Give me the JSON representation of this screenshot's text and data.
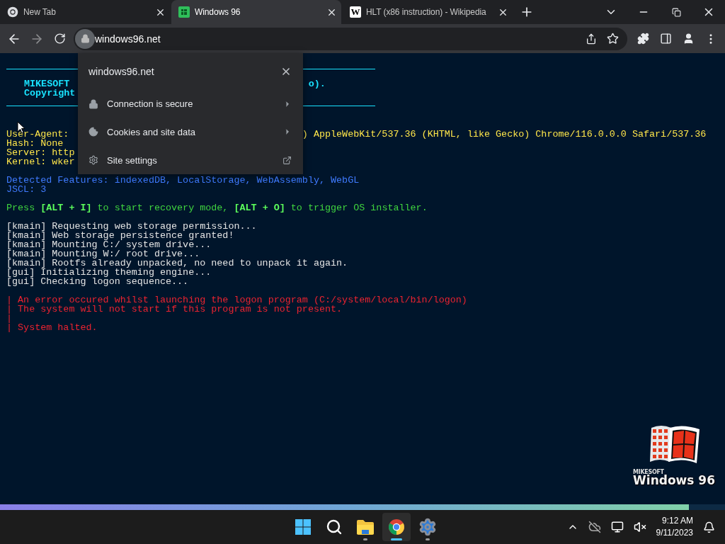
{
  "browser": {
    "tabs": [
      {
        "title": "New Tab",
        "selected": false
      },
      {
        "title": "Windows 96",
        "selected": true
      },
      {
        "title": "HLT (x86 instruction) - Wikipedia",
        "icon_text": "W",
        "selected": false
      }
    ],
    "address": "windows96.net"
  },
  "site_popup": {
    "title": "windows96.net",
    "items": [
      {
        "label": "Connection is secure",
        "kind": "submenu"
      },
      {
        "label": "Cookies and site data",
        "kind": "submenu"
      },
      {
        "label": "Site settings",
        "kind": "external"
      }
    ]
  },
  "terminal": {
    "blocks": [
      {
        "kind": "header",
        "lines": [
          {
            "text": "MIKESOFT ",
            "tail": "o)."
          },
          {
            "text": "Copyright"
          }
        ]
      },
      {
        "kind": "info",
        "lines": [
          {
            "text": "User-Agent:",
            "tail": ") AppleWebKit/537.36 (KHTML, like Gecko) Chrome/116.0.0.0 Safari/537.36"
          },
          {
            "text": "Hash: None"
          },
          {
            "text": "Server: http"
          },
          {
            "text": "Kernel: wker"
          }
        ]
      },
      {
        "kind": "feature",
        "lines": [
          {
            "text": "Detected Features: indexedDB, LocalStorage, WebAssembly, WebGL"
          },
          {
            "text": "JSCL: 3"
          }
        ]
      },
      {
        "kind": "hint",
        "lines": [
          {
            "text": "Press **[ALT + I]** to start recovery mode, **[ALT + O]** to trigger OS installer."
          }
        ]
      },
      {
        "kind": "log",
        "lines": [
          {
            "text": "[kmain] Requesting web storage permission..."
          },
          {
            "text": "[kmain] Web storage persistence granted!"
          },
          {
            "text": "[kmain] Mounting C:/ system drive..."
          },
          {
            "text": "[kmain] Mounting W:/ root drive..."
          },
          {
            "text": "[kmain] Rootfs already unpacked, no need to unpack it again."
          },
          {
            "text": "[gui] Initializing theming engine..."
          },
          {
            "text": "[gui] Checking logon sequence..."
          }
        ]
      },
      {
        "kind": "error",
        "lines": [
          {
            "text": "| An error occured whilst launching the logon program (C:/system/local/bin/logon)"
          },
          {
            "text": "| The system will not start if this program is not present."
          },
          {
            "text": "|"
          },
          {
            "text": "| System halted."
          }
        ]
      }
    ]
  },
  "progress": {
    "level": 0.95
  },
  "logo": {
    "brand": "MIKESOFT",
    "name": "Windows 96"
  },
  "taskbar": {
    "apps": [
      {
        "kind": "start",
        "selected": false,
        "running": false
      },
      {
        "kind": "search",
        "selected": false,
        "running": false
      },
      {
        "kind": "folder",
        "selected": false,
        "running": true
      },
      {
        "kind": "chrome",
        "selected": true,
        "running": true
      },
      {
        "kind": "settings",
        "selected": false,
        "running": true
      }
    ],
    "time": "9:12 AM",
    "date": "9/11/2023"
  }
}
